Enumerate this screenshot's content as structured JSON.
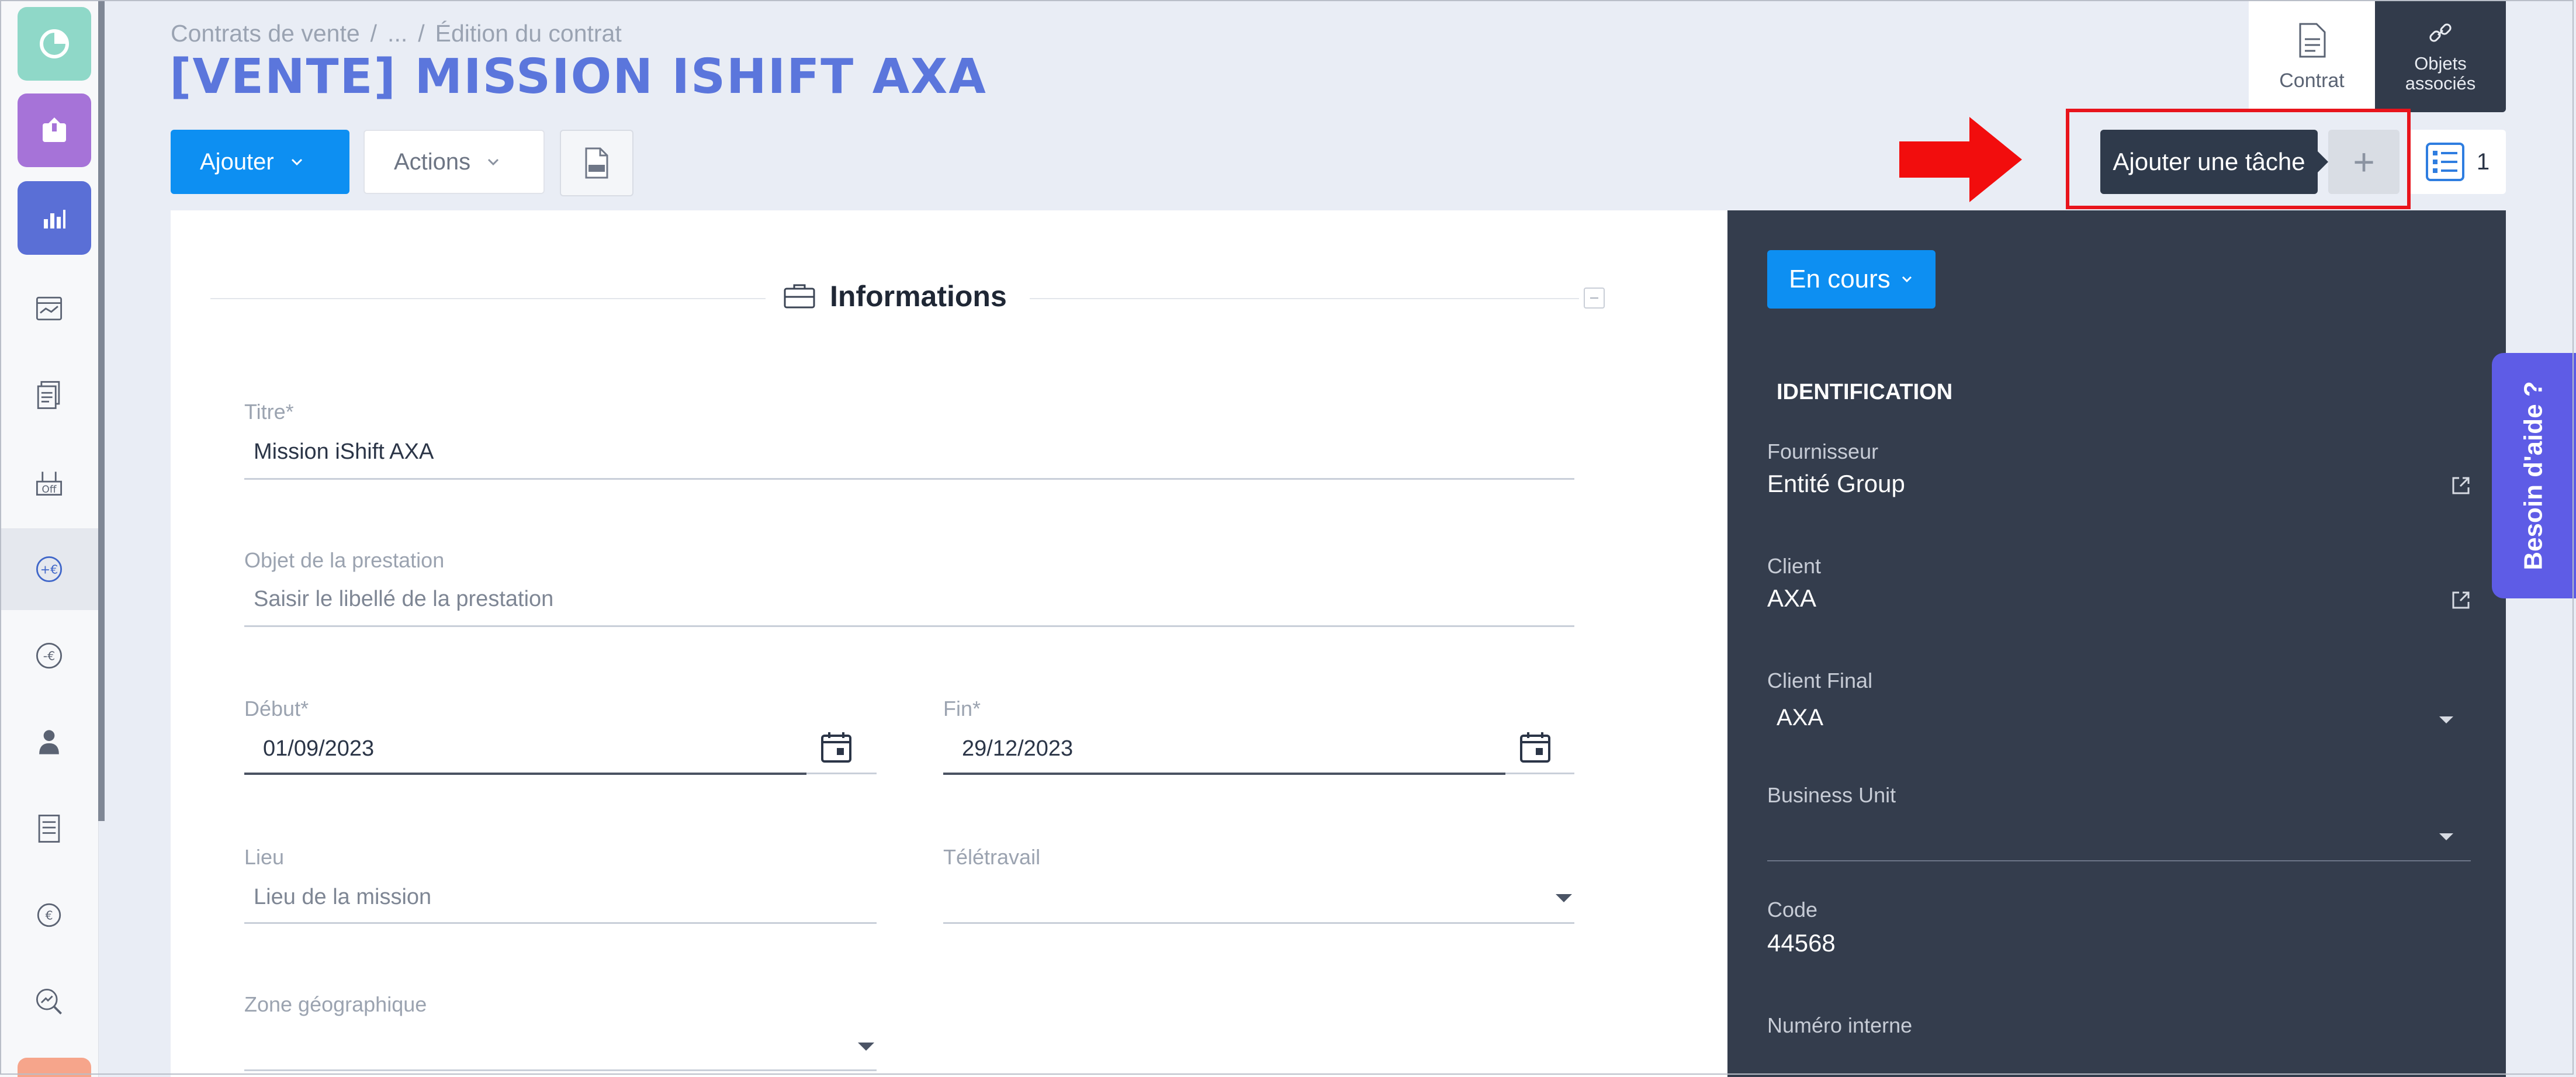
{
  "breadcrumb": {
    "item1": "Contrats de vente",
    "sep1": "/",
    "item2": "...",
    "sep2": "/",
    "item3": "Édition du contrat"
  },
  "page_title": "[VENTE] MISSION ISHIFT AXA",
  "top_tabs": {
    "contrat": "Contrat",
    "objets_line1": "Objets",
    "objets_line2": "associés"
  },
  "toolbar": {
    "ajouter": "Ajouter",
    "actions": "Actions",
    "doc_icon": "docx-file-icon"
  },
  "tooltip": "Ajouter une tâche",
  "add_task_symbol": "+",
  "tasks_count": "1",
  "section": {
    "title": "Informations",
    "icon": "briefcase-icon"
  },
  "form": {
    "titre": {
      "label": "Titre*",
      "value": "Mission iShift AXA"
    },
    "objet": {
      "label": "Objet de la prestation",
      "placeholder": "Saisir le libellé de la prestation"
    },
    "debut": {
      "label": "Début*",
      "value": "01/09/2023"
    },
    "fin": {
      "label": "Fin*",
      "value": "29/12/2023"
    },
    "lieu": {
      "label": "Lieu",
      "placeholder": "Lieu de la mission"
    },
    "teletravail": {
      "label": "Télétravail",
      "value": ""
    },
    "zone": {
      "label": "Zone géographique",
      "value": ""
    }
  },
  "panel": {
    "status": "En cours",
    "heading": "IDENTIFICATION",
    "fournisseur": {
      "label": "Fournisseur",
      "value": "Entité Group"
    },
    "client": {
      "label": "Client",
      "value": "AXA"
    },
    "client_final": {
      "label": "Client Final",
      "value": "AXA"
    },
    "business_unit": {
      "label": "Business Unit",
      "value": ""
    },
    "code": {
      "label": "Code",
      "value": "44568"
    },
    "numero_interne": {
      "label": "Numéro interne"
    }
  },
  "help": "Besoin d'aide ?",
  "colors": {
    "primary": "#0d8ff2",
    "title": "#5b76dc",
    "panel": "#343d4d",
    "help": "#5e5ce6",
    "highlight": "#e8141c"
  }
}
